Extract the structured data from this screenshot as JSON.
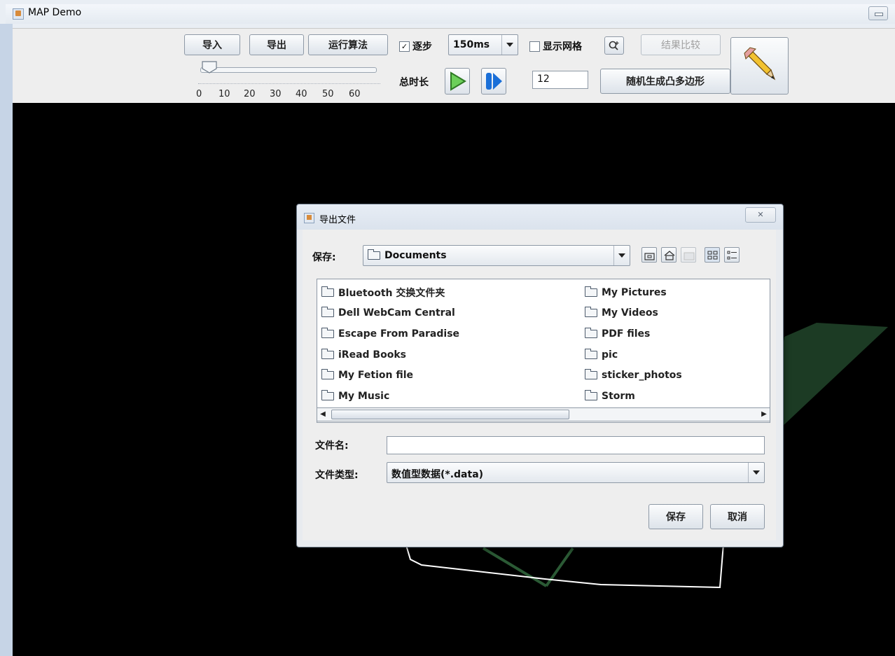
{
  "window": {
    "title": "MAP Demo"
  },
  "toolbar": {
    "import_label": "导入",
    "export_label": "导出",
    "run_label": "运行算法",
    "step_label": "逐步",
    "step_checked": true,
    "speed_value": "150ms",
    "grid_label": "显示网格",
    "grid_checked": false,
    "compare_label": "结果比较",
    "total_time_label": "总时长",
    "count_value": "12",
    "random_polygon_label": "随机生成凸多边形",
    "slider_labels": [
      "0",
      "10",
      "20",
      "30",
      "40",
      "50",
      "60"
    ],
    "slider_value": 5
  },
  "dialog": {
    "title": "导出文件",
    "save_in_label": "保存:",
    "location_value": "Documents",
    "files_left": [
      "Bluetooth 交换文件夹",
      "Dell WebCam Central",
      "Escape From Paradise",
      "iRead Books",
      "My Fetion file",
      "My Music"
    ],
    "files_right": [
      "My Pictures",
      "My Videos",
      "PDF files",
      "pic",
      "sticker_photos",
      "Storm"
    ],
    "filename_label": "文件名:",
    "filename_value": "",
    "filetype_label": "文件类型:",
    "filetype_value": "数值型数据(*.data)",
    "save_button": "保存",
    "cancel_button": "取消"
  },
  "icons": [
    "app-icon",
    "minimize-icon",
    "zoom-in-icon",
    "pencil-icon",
    "play-icon",
    "step-forward-icon",
    "folder-icon",
    "up-folder-icon",
    "home-icon",
    "new-folder-icon",
    "list-view-icon",
    "details-view-icon",
    "close-icon"
  ],
  "colors": {
    "canvas_bg": "#000000",
    "polygon_fill": "#1c3b24",
    "polygon_edge": "#ffffff",
    "play_green": "#5ec04e",
    "step_blue": "#1a6fd8"
  }
}
